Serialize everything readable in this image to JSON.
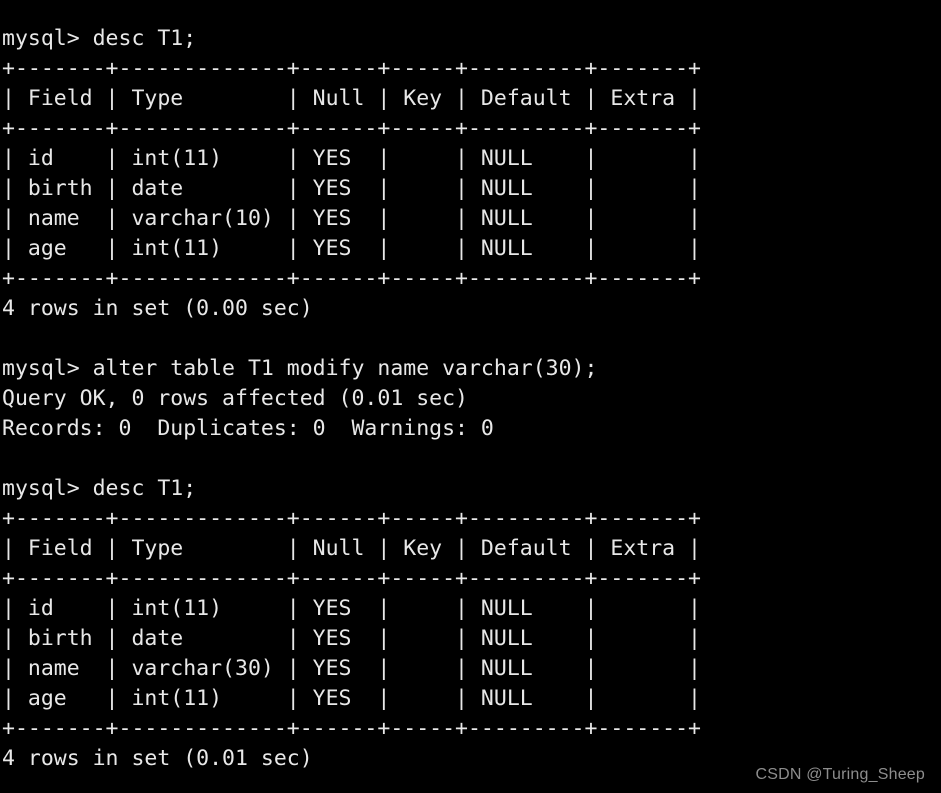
{
  "terminal": {
    "prompt": "mysql> ",
    "background_color": "#000000",
    "text_color": "#e8e8e8",
    "lines": [
      "mysql> desc T1;",
      "+-------+-------------+------+-----+---------+-------+",
      "| Field | Type        | Null | Key | Default | Extra |",
      "+-------+-------------+------+-----+---------+-------+",
      "| id    | int(11)     | YES  |     | NULL    |       |",
      "| birth | date        | YES  |     | NULL    |       |",
      "| name  | varchar(10) | YES  |     | NULL    |       |",
      "| age   | int(11)     | YES  |     | NULL    |       |",
      "+-------+-------------+------+-----+---------+-------+",
      "4 rows in set (0.00 sec)",
      "",
      "mysql> alter table T1 modify name varchar(30);",
      "Query OK, 0 rows affected (0.01 sec)",
      "Records: 0  Duplicates: 0  Warnings: 0",
      "",
      "mysql> desc T1;",
      "+-------+-------------+------+-----+---------+-------+",
      "| Field | Type        | Null | Key | Default | Extra |",
      "+-------+-------------+------+-----+---------+-------+",
      "| id    | int(11)     | YES  |     | NULL    |       |",
      "| birth | date        | YES  |     | NULL    |       |",
      "| name  | varchar(30) | YES  |     | NULL    |       |",
      "| age   | int(11)     | YES  |     | NULL    |       |",
      "+-------+-------------+------+-----+---------+-------+",
      "4 rows in set (0.01 sec)"
    ],
    "commands": [
      "desc T1;",
      "alter table T1 modify name varchar(30);",
      "desc T1;"
    ],
    "results": {
      "first_desc": {
        "columns": [
          "Field",
          "Type",
          "Null",
          "Key",
          "Default",
          "Extra"
        ],
        "rows": [
          [
            "id",
            "int(11)",
            "YES",
            "",
            "NULL",
            ""
          ],
          [
            "birth",
            "date",
            "YES",
            "",
            "NULL",
            ""
          ],
          [
            "name",
            "varchar(10)",
            "YES",
            "",
            "NULL",
            ""
          ],
          [
            "age",
            "int(11)",
            "YES",
            "",
            "NULL",
            ""
          ]
        ],
        "status": "4 rows in set (0.00 sec)"
      },
      "alter": {
        "status": "Query OK, 0 rows affected (0.01 sec)",
        "detail": "Records: 0  Duplicates: 0  Warnings: 0"
      },
      "second_desc": {
        "columns": [
          "Field",
          "Type",
          "Null",
          "Key",
          "Default",
          "Extra"
        ],
        "rows": [
          [
            "id",
            "int(11)",
            "YES",
            "",
            "NULL",
            ""
          ],
          [
            "birth",
            "date",
            "YES",
            "",
            "NULL",
            ""
          ],
          [
            "name",
            "varchar(30)",
            "YES",
            "",
            "NULL",
            ""
          ],
          [
            "age",
            "int(11)",
            "YES",
            "",
            "NULL",
            ""
          ]
        ],
        "status": "4 rows in set (0.01 sec)"
      }
    }
  },
  "watermark": {
    "text": "CSDN @Turing_Sheep"
  }
}
